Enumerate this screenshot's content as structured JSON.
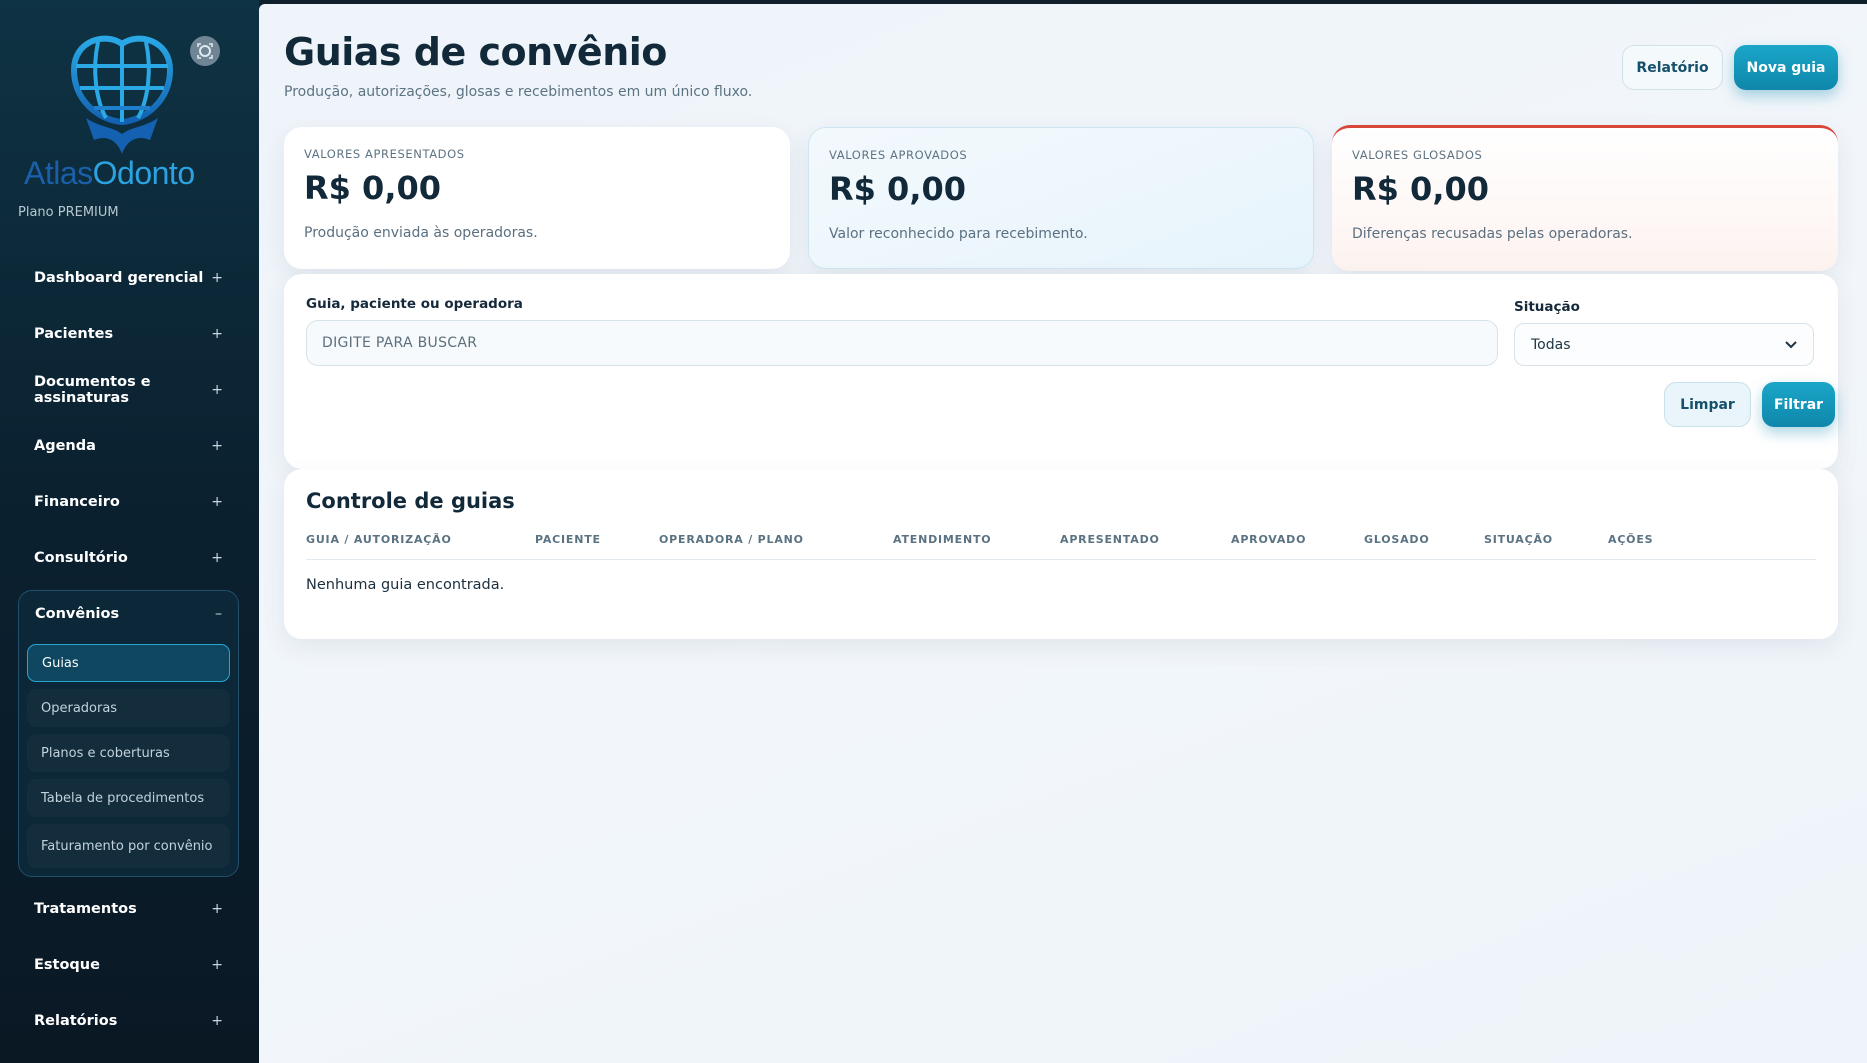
{
  "brand": {
    "name_part1": "Atlas",
    "name_part2": "Odonto",
    "plan": "Plano PREMIUM",
    "logo_icon": "globe-tooth-icon",
    "colors": {
      "primary": "#1a5fa8",
      "accent": "#2da2e0"
    }
  },
  "sidebar": {
    "items": [
      {
        "label": "Dashboard gerencial",
        "toggle": "+"
      },
      {
        "label": "Pacientes",
        "toggle": "+"
      },
      {
        "label": "Documentos e assinaturas",
        "toggle": "+"
      },
      {
        "label": "Agenda",
        "toggle": "+"
      },
      {
        "label": "Financeiro",
        "toggle": "+"
      },
      {
        "label": "Consultório",
        "toggle": "+"
      }
    ],
    "group": {
      "label": "Convênios",
      "toggle": "–",
      "subitems": [
        {
          "label": "Guias",
          "active": true
        },
        {
          "label": "Operadoras"
        },
        {
          "label": "Planos e coberturas"
        },
        {
          "label": "Tabela de procedimentos"
        },
        {
          "label": "Faturamento por convênio"
        }
      ]
    },
    "items_after": [
      {
        "label": "Tratamentos",
        "toggle": "+"
      },
      {
        "label": "Estoque",
        "toggle": "+"
      },
      {
        "label": "Relatórios",
        "toggle": "+"
      }
    ]
  },
  "header": {
    "title": "Guias de convênio",
    "subtitle": "Produção, autorizações, glosas e recebimentos em um único fluxo.",
    "report_button": "Relatório",
    "new_button": "Nova guia"
  },
  "stats": [
    {
      "label": "VALORES APRESENTADOS",
      "value": "R$ 0,00",
      "note": "Produção enviada às operadoras."
    },
    {
      "label": "VALORES APROVADOS",
      "value": "R$ 0,00",
      "note": "Valor reconhecido para recebimento."
    },
    {
      "label": "VALORES GLOSADOS",
      "value": "R$ 0,00",
      "note": "Diferenças recusadas pelas operadoras."
    }
  ],
  "filters": {
    "search_label": "Guia, paciente ou operadora",
    "search_placeholder": "DIGITE PARA BUSCAR",
    "status_label": "Situação",
    "status_value": "Todas",
    "clear_button": "Limpar",
    "filter_button": "Filtrar"
  },
  "table": {
    "title": "Controle de guias",
    "columns": [
      "GUIA / AUTORIZAÇÃO",
      "PACIENTE",
      "OPERADORA / PLANO",
      "ATENDIMENTO",
      "APRESENTADO",
      "APROVADO",
      "GLOSADO",
      "SITUAÇÃO",
      "AÇÕES"
    ],
    "empty_message": "Nenhuma guia encontrada."
  }
}
